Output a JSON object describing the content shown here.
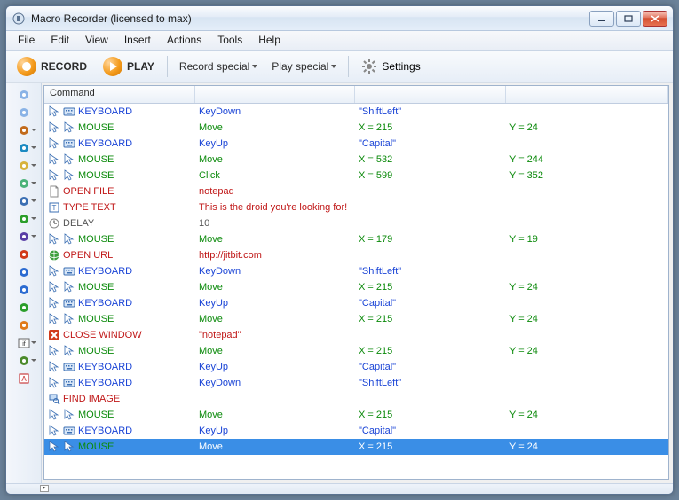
{
  "title": "Macro Recorder (licensed to max)",
  "menu": [
    "File",
    "Edit",
    "View",
    "Insert",
    "Actions",
    "Tools",
    "Help"
  ],
  "toolbar": {
    "record": "RECORD",
    "play": "PLAY",
    "record_special": "Record special",
    "play_special": "Play special",
    "settings": "Settings"
  },
  "grid": {
    "header": "Command",
    "rows": [
      {
        "type": "keyboard",
        "cmd": "KEYBOARD",
        "c1": "KeyDown",
        "c2": "\"ShiftLeft\"",
        "c3": "",
        "sel": false
      },
      {
        "type": "mouse",
        "cmd": "MOUSE",
        "c1": "Move",
        "c2": "X = 215",
        "c3": "Y = 24",
        "sel": false
      },
      {
        "type": "keyboard",
        "cmd": "KEYBOARD",
        "c1": "KeyUp",
        "c2": "\"Capital\"",
        "c3": "",
        "sel": false
      },
      {
        "type": "mouse",
        "cmd": "MOUSE",
        "c1": "Move",
        "c2": "X = 532",
        "c3": "Y = 244",
        "sel": false
      },
      {
        "type": "mouse",
        "cmd": "MOUSE",
        "c1": "Click",
        "c2": "X = 599",
        "c3": "Y = 352",
        "sel": false
      },
      {
        "type": "openfile",
        "cmd": "OPEN FILE",
        "c1": "notepad",
        "c2": "",
        "c3": "",
        "sel": false
      },
      {
        "type": "typetext",
        "cmd": "TYPE TEXT",
        "c1": "This is the droid you're looking for!",
        "c2": "",
        "c3": "",
        "sel": false
      },
      {
        "type": "delay",
        "cmd": "DELAY",
        "c1": "10",
        "c2": "",
        "c3": "",
        "sel": false
      },
      {
        "type": "mouse",
        "cmd": "MOUSE",
        "c1": "Move",
        "c2": "X = 179",
        "c3": "Y = 19",
        "sel": false
      },
      {
        "type": "openurl",
        "cmd": "OPEN URL",
        "c1": "http://jitbit.com",
        "c2": "",
        "c3": "",
        "sel": false
      },
      {
        "type": "keyboard",
        "cmd": "KEYBOARD",
        "c1": "KeyDown",
        "c2": "\"ShiftLeft\"",
        "c3": "",
        "sel": false
      },
      {
        "type": "mouse",
        "cmd": "MOUSE",
        "c1": "Move",
        "c2": "X = 215",
        "c3": "Y = 24",
        "sel": false
      },
      {
        "type": "keyboard",
        "cmd": "KEYBOARD",
        "c1": "KeyUp",
        "c2": "\"Capital\"",
        "c3": "",
        "sel": false
      },
      {
        "type": "mouse",
        "cmd": "MOUSE",
        "c1": "Move",
        "c2": "X = 215",
        "c3": "Y = 24",
        "sel": false
      },
      {
        "type": "closewin",
        "cmd": "CLOSE WINDOW",
        "c1": "\"notepad\"",
        "c2": "",
        "c3": "",
        "sel": false
      },
      {
        "type": "mouse",
        "cmd": "MOUSE",
        "c1": "Move",
        "c2": "X = 215",
        "c3": "Y = 24",
        "sel": false
      },
      {
        "type": "keyboard",
        "cmd": "KEYBOARD",
        "c1": "KeyUp",
        "c2": "\"Capital\"",
        "c3": "",
        "sel": false
      },
      {
        "type": "keyboard",
        "cmd": "KEYBOARD",
        "c1": "KeyDown",
        "c2": "\"ShiftLeft\"",
        "c3": "",
        "sel": false
      },
      {
        "type": "findimage",
        "cmd": "FIND IMAGE",
        "c1": "",
        "c2": "",
        "c3": "",
        "sel": false
      },
      {
        "type": "mouse",
        "cmd": "MOUSE",
        "c1": "Move",
        "c2": "X = 215",
        "c3": "Y = 24",
        "sel": false
      },
      {
        "type": "keyboard",
        "cmd": "KEYBOARD",
        "c1": "KeyUp",
        "c2": "\"Capital\"",
        "c3": "",
        "sel": false
      },
      {
        "type": "mouse",
        "cmd": "MOUSE",
        "c1": "Move",
        "c2": "X = 215",
        "c3": "Y = 24",
        "sel": true
      }
    ]
  },
  "sidebar_icons": [
    {
      "name": "mouse-icon",
      "dd": false,
      "fill": "#8ab3e6"
    },
    {
      "name": "keyboard-icon",
      "dd": false,
      "fill": "#8ab3e6"
    },
    {
      "name": "delay-icon",
      "dd": true,
      "fill": "#c26b1c"
    },
    {
      "name": "repeat-icon",
      "dd": true,
      "fill": "#1c8ac2"
    },
    {
      "name": "file-icon",
      "dd": true,
      "fill": "#d7b23b"
    },
    {
      "name": "copy-icon",
      "dd": true,
      "fill": "#4bb37a"
    },
    {
      "name": "type-icon",
      "dd": true,
      "fill": "#3b6fb3"
    },
    {
      "name": "color-picker-icon",
      "dd": true,
      "fill": "#2b9e2b"
    },
    {
      "name": "image-icon",
      "dd": true,
      "fill": "#5a3fa6"
    },
    {
      "name": "power-icon",
      "dd": false,
      "fill": "#d13a1a"
    },
    {
      "name": "web-icon",
      "dd": false,
      "fill": "#2b6bd1"
    },
    {
      "name": "info-icon",
      "dd": false,
      "fill": "#2b6bd1"
    },
    {
      "name": "refresh-icon",
      "dd": false,
      "fill": "#2b9e2b"
    },
    {
      "name": "play-small-icon",
      "dd": false,
      "fill": "#e07a1a"
    },
    {
      "name": "if-icon",
      "dd": true,
      "fill": "#333"
    },
    {
      "name": "goto-icon",
      "dd": true,
      "fill": "#4b8a2b"
    },
    {
      "name": "label-icon",
      "dd": false,
      "fill": "#c01818"
    }
  ]
}
